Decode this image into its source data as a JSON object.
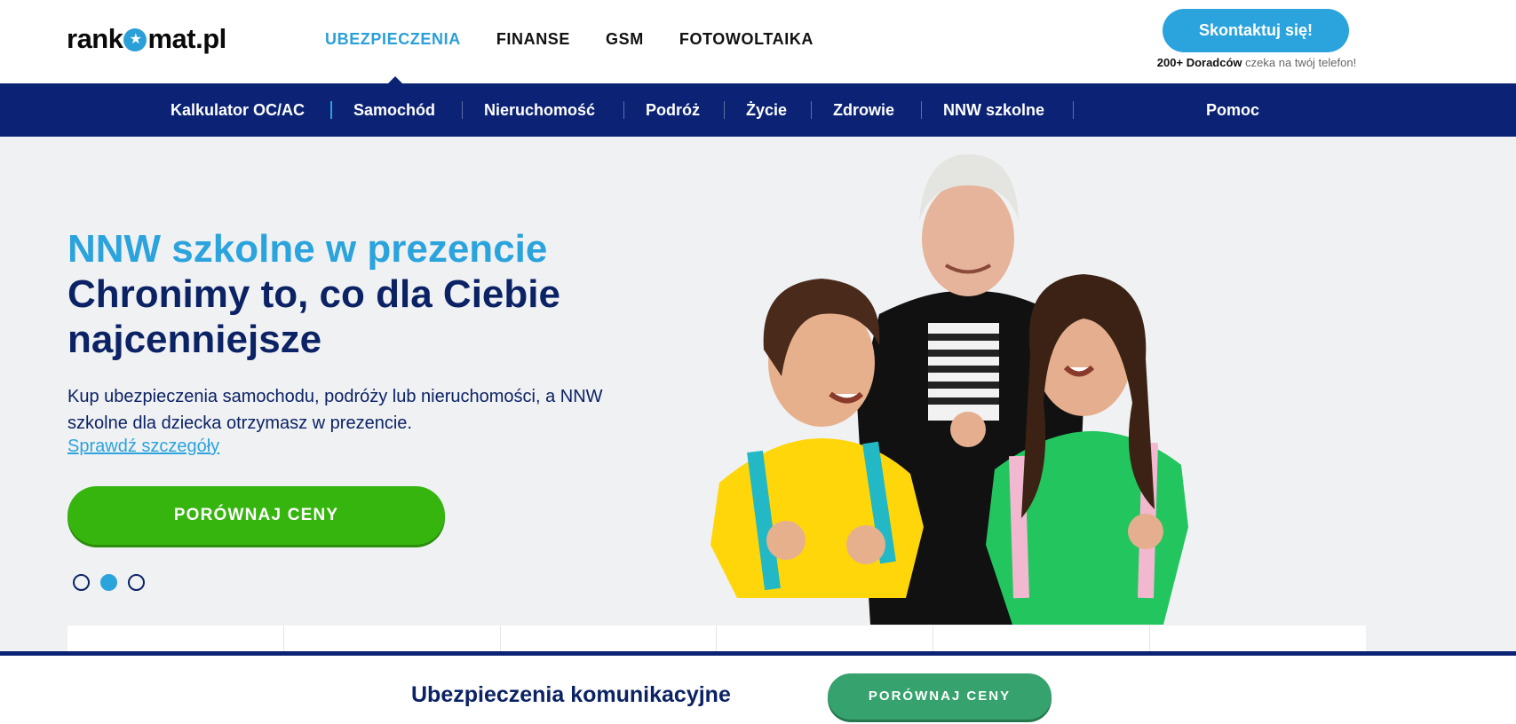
{
  "header": {
    "logo_left": "rank",
    "logo_right": "mat.pl",
    "nav": [
      "UBEZPIECZENIA",
      "FINANSE",
      "GSM",
      "FOTOWOLTAIKA"
    ],
    "contact_button": "Skontaktuj się!",
    "advisors_bold": "200+ Doradców",
    "advisors_text": "czeka na twój telefon!"
  },
  "subnav": {
    "items": [
      "Kalkulator OC/AC",
      "Samochód",
      "Nieruchomość",
      "Podróż",
      "Życie",
      "Zdrowie",
      "NNW szkolne",
      "Pomoc"
    ]
  },
  "hero": {
    "title_line1": "NNW szkolne w prezencie",
    "title_line2": "Chronimy to, co dla Ciebie",
    "title_line3": "najcenniejsze",
    "description": "Kup ubezpieczenia samochodu, podróży lub nieruchomości, a NNW szkolne dla dziecka otrzymasz w prezencie.",
    "link": "Sprawdź szczegóły",
    "cta": "PORÓWNAJ CENY",
    "slides": {
      "count": 3,
      "active_index": 1
    }
  },
  "sticky": {
    "title": "Ubezpieczenia komunikacyjne",
    "button": "PORÓWNAJ CENY"
  },
  "colors": {
    "brand_blue": "#2ba3dd",
    "navy": "#0b2275",
    "green_cta": "#36b50f",
    "green_sticky": "#36a26d"
  }
}
